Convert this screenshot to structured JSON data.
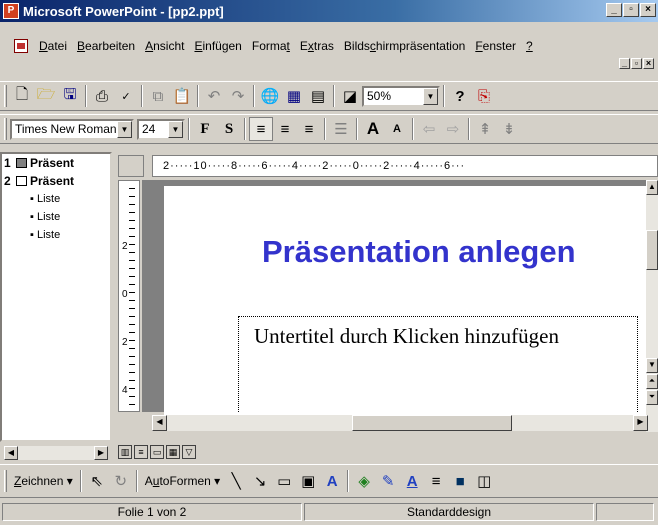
{
  "window": {
    "title": "Microsoft PowerPoint - [pp2.ppt]",
    "app_icon_label": "P"
  },
  "menubar": {
    "items": [
      {
        "pre": "",
        "u": "D",
        "post": "atei"
      },
      {
        "pre": "",
        "u": "B",
        "post": "earbeiten"
      },
      {
        "pre": "",
        "u": "A",
        "post": "nsicht"
      },
      {
        "pre": "",
        "u": "E",
        "post": "infügen"
      },
      {
        "pre": "Forma",
        "u": "t",
        "post": ""
      },
      {
        "pre": "E",
        "u": "x",
        "post": "tras"
      },
      {
        "pre": "Bilds",
        "u": "c",
        "post": "hirmpräsentation"
      },
      {
        "pre": "",
        "u": "F",
        "post": "enster"
      },
      {
        "pre": "",
        "u": "?",
        "post": ""
      }
    ]
  },
  "standard_toolbar": {
    "zoom": "50%"
  },
  "format_toolbar": {
    "font": "Times New Roman",
    "size": "24",
    "bold": "F",
    "shadow": "S"
  },
  "outline": {
    "slides": [
      {
        "num": "1",
        "title": "Präsent"
      },
      {
        "num": "2",
        "title": "Präsent"
      }
    ],
    "bullets": [
      "Liste",
      "Liste",
      "Liste"
    ]
  },
  "ruler": {
    "h_text": "2·····10·····8·····6·····4·····2·····0·····2·····4·····6···",
    "v_labels": [
      "2",
      "0",
      "2",
      "4"
    ]
  },
  "slide": {
    "title": "Präsentation anlegen",
    "subtitle": "Untertitel durch Klicken hinzufügen"
  },
  "drawing_toolbar": {
    "draw_pre": "",
    "draw_u": "Z",
    "draw_post": "eichnen",
    "autoshapes_pre": "A",
    "autoshapes_u": "u",
    "autoshapes_post": "toFormen"
  },
  "statusbar": {
    "slide_info": "Folie 1 von 2",
    "design": "Standarddesign"
  }
}
